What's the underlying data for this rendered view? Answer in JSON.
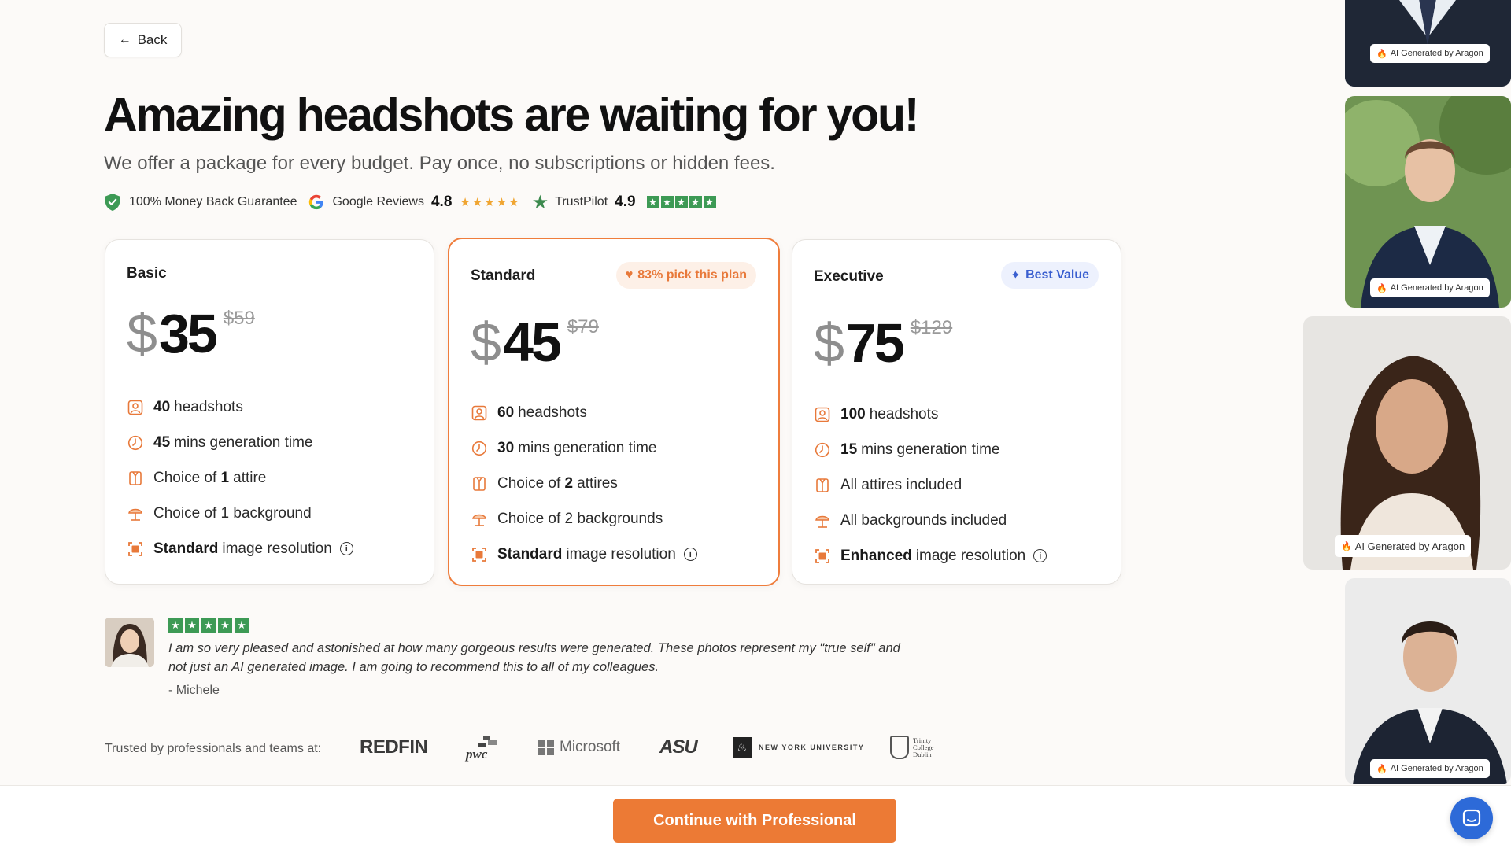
{
  "back": {
    "label": "Back"
  },
  "header": {
    "title": "Amazing headshots are waiting for you!",
    "subtitle": "We offer a package for every budget. Pay once, no subscriptions or hidden fees."
  },
  "trust": {
    "guarantee": "100% Money Back Guarantee",
    "google_label": "Google Reviews",
    "google_score": "4.8",
    "google_stars": "★★★★★",
    "trustpilot_label": "TrustPilot",
    "trustpilot_score": "4.9"
  },
  "plans": [
    {
      "name": "Basic",
      "currency": "$",
      "price": "35",
      "old_price": "$59",
      "badge": "",
      "features": [
        {
          "icon": "portrait-icon",
          "bold": "40",
          "text": "headshots"
        },
        {
          "icon": "clock-icon",
          "bold": "45",
          "text": "mins generation time"
        },
        {
          "icon": "attire-icon",
          "pre": "Choice of ",
          "bold": "1",
          "text": "attire"
        },
        {
          "icon": "beach-umbrella-icon",
          "text": "Choice of 1 background"
        },
        {
          "icon": "resolution-icon",
          "bold": "Standard",
          "text": "image resolution",
          "info": true
        }
      ]
    },
    {
      "name": "Standard",
      "currency": "$",
      "price": "45",
      "old_price": "$79",
      "badge": "83% pick this plan",
      "features": [
        {
          "icon": "portrait-icon",
          "bold": "60",
          "text": "headshots"
        },
        {
          "icon": "clock-icon",
          "bold": "30",
          "text": "mins generation time"
        },
        {
          "icon": "attire-icon",
          "pre": "Choice of ",
          "bold": "2",
          "text": "attires"
        },
        {
          "icon": "beach-umbrella-icon",
          "text": "Choice of 2 backgrounds"
        },
        {
          "icon": "resolution-icon",
          "bold": "Standard",
          "text": "image resolution",
          "info": true
        }
      ]
    },
    {
      "name": "Executive",
      "currency": "$",
      "price": "75",
      "old_price": "$129",
      "badge": "Best Value",
      "features": [
        {
          "icon": "portrait-icon",
          "bold": "100",
          "text": "headshots"
        },
        {
          "icon": "clock-icon",
          "bold": "15",
          "text": "mins generation time"
        },
        {
          "icon": "attire-icon",
          "text": "All attires included"
        },
        {
          "icon": "beach-umbrella-icon",
          "text": "All backgrounds included"
        },
        {
          "icon": "resolution-icon",
          "bold": "Enhanced",
          "text": "image resolution",
          "info": true
        }
      ]
    }
  ],
  "review": {
    "text": "I am so very pleased and astonished at how many gorgeous results were generated. These photos represent my \"true self\" and not just an AI generated image. I am going to recommend this to all of my colleagues.",
    "author": "- Michele"
  },
  "trusted": {
    "label": "Trusted by professionals and teams at:",
    "logos": {
      "redfin": "REDFIN",
      "pwc": "pwc",
      "microsoft": "Microsoft",
      "asu": "ASU",
      "nyu": "NEW YORK UNIVERSITY",
      "tcd_1": "Trinity",
      "tcd_2": "College",
      "tcd_3": "Dublin"
    }
  },
  "gallery": {
    "tag": "AI Generated by Aragon"
  },
  "cta": {
    "label": "Continue with Professional"
  },
  "colors": {
    "accent": "#ec7a35",
    "trustpilot_green": "#3d9a55",
    "best_value_blue": "#3a5fd0",
    "chat_blue": "#2d6ad8"
  }
}
